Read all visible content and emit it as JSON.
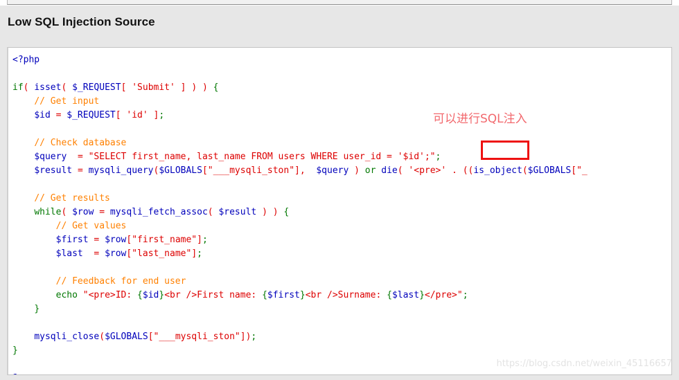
{
  "page": {
    "title": "Low SQL Injection Source",
    "background_color": "#e7e7e7",
    "panel_background": "#ffffff"
  },
  "annotation": {
    "text": "可以进行SQL注入",
    "color": "#f2696e",
    "meaning": "SQL injection is possible here"
  },
  "highlight": {
    "target_text": "'$id';\"",
    "border_color": "#ee1111"
  },
  "watermark": {
    "text": "https://blog.csdn.net/weixin_45116657",
    "color": "#e3e3e3"
  },
  "syntax_colors": {
    "keyword": "#007700",
    "function": "#0000bb",
    "variable": "#0000bb",
    "string": "#dd0000",
    "comment": "#ff8000",
    "default": "#202020"
  },
  "code": {
    "language": "php",
    "lines": [
      "<?php",
      "",
      "if( isset( $_REQUEST[ 'Submit' ] ) ) {",
      "    // Get input",
      "    $id = $_REQUEST[ 'id' ];",
      "",
      "    // Check database",
      "    $query  = \"SELECT first_name, last_name FROM users WHERE user_id = '$id';\";",
      "    $result = mysqli_query($GLOBALS[\"___mysqli_ston\"],  $query ) or die( '<pre>' . ((is_object($GLOBALS[\"_",
      "",
      "    // Get results",
      "    while( $row = mysqli_fetch_assoc( $result ) ) {",
      "        // Get values",
      "        $first = $row[\"first_name\"];",
      "        $last  = $row[\"last_name\"];",
      "",
      "        // Feedback for end user",
      "        echo \"<pre>ID: {$id}<br />First name: {$first}<br />Surname: {$last}</pre>\";",
      "    }",
      "",
      "    mysqli_close($GLOBALS[\"___mysqli_ston\"]);",
      "}",
      "",
      "?>"
    ]
  }
}
